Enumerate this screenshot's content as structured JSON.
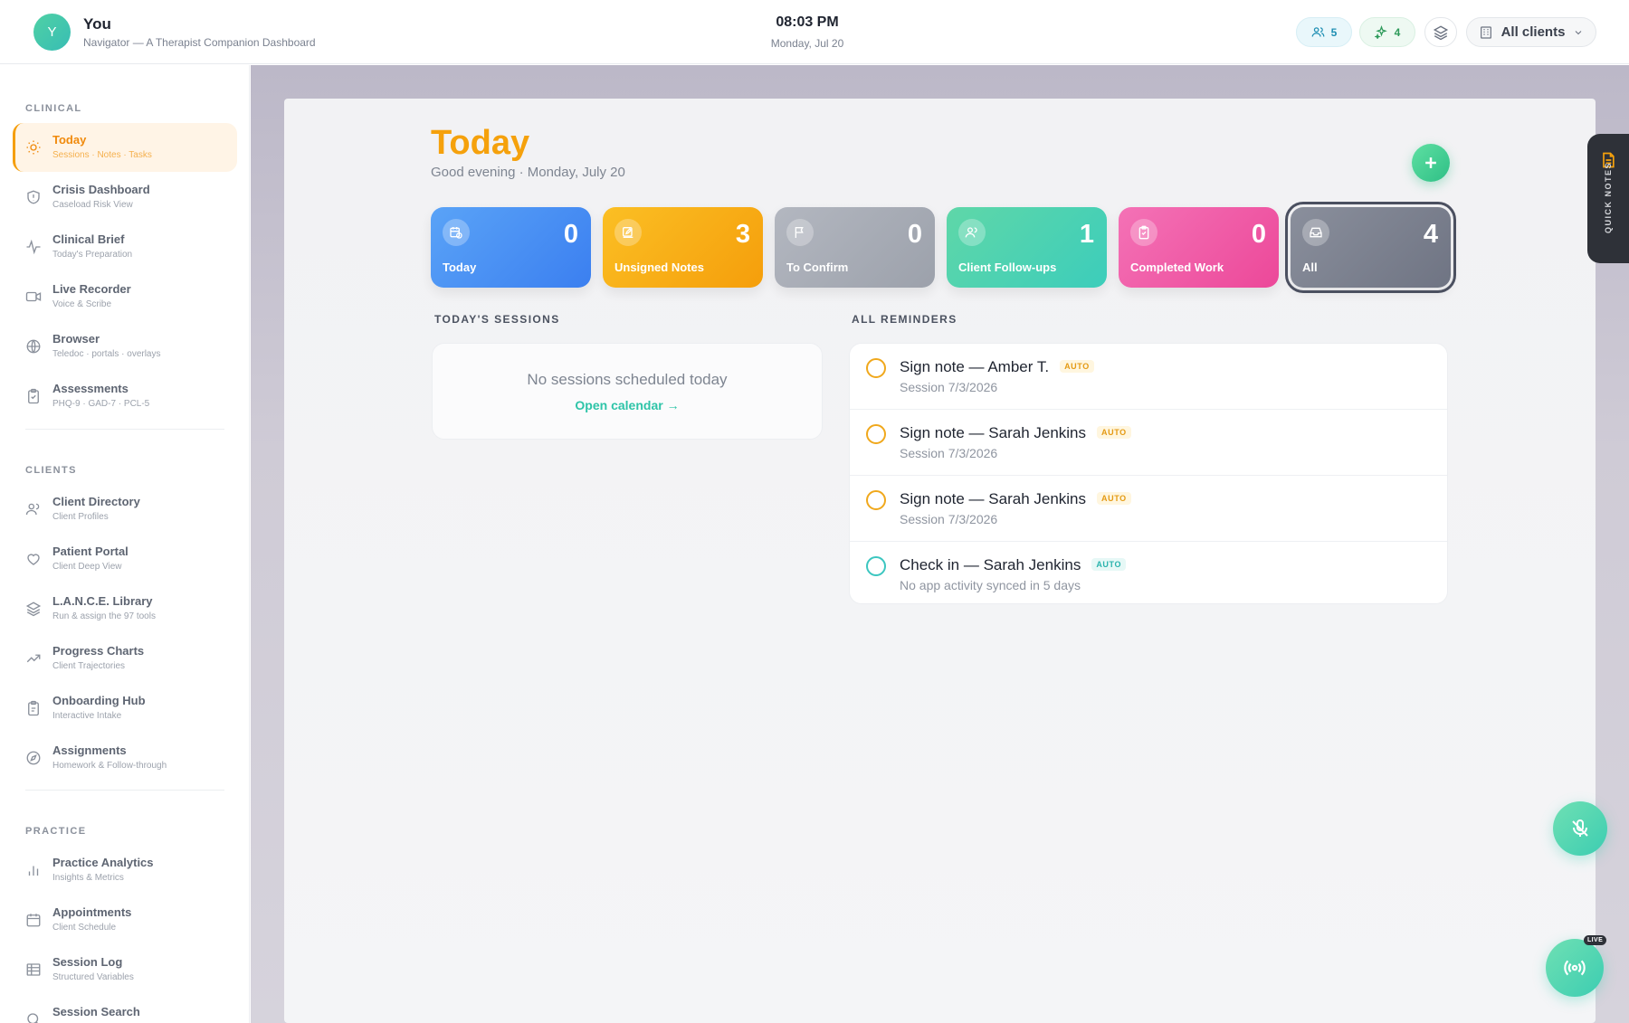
{
  "header": {
    "avatar_initial": "Y",
    "user_name": "You",
    "user_sub": "Navigator — A Therapist Companion Dashboard",
    "time": "08:03 PM",
    "date": "Monday, Jul 20",
    "clients_count": "5",
    "sparkle_count": "4",
    "client_select": "All clients"
  },
  "sidebar": {
    "clinical_title": "CLINICAL",
    "clients_title": "CLIENTS",
    "practice_title": "PRACTICE",
    "clinical": [
      {
        "label": "Today",
        "sub": "Sessions · Notes · Tasks",
        "icon": "sun-icon"
      },
      {
        "label": "Crisis Dashboard",
        "sub": "Caseload Risk View",
        "icon": "shield-icon"
      },
      {
        "label": "Clinical Brief",
        "sub": "Today's Preparation",
        "icon": "pulse-icon"
      },
      {
        "label": "Live Recorder",
        "sub": "Voice & Scribe",
        "icon": "video-icon"
      },
      {
        "label": "Browser",
        "sub": "Teledoc · portals · overlays",
        "icon": "globe-icon"
      },
      {
        "label": "Assessments",
        "sub": "PHQ-9 · GAD-7 · PCL-5",
        "icon": "clipboard-icon"
      }
    ],
    "clients": [
      {
        "label": "Client Directory",
        "sub": "Client Profiles",
        "icon": "users-icon"
      },
      {
        "label": "Patient Portal",
        "sub": "Client Deep View",
        "icon": "heart-icon"
      },
      {
        "label": "L.A.N.C.E. Library",
        "sub": "Run & assign the 97 tools",
        "icon": "layers-icon"
      },
      {
        "label": "Progress Charts",
        "sub": "Client Trajectories",
        "icon": "trend-icon"
      },
      {
        "label": "Onboarding Hub",
        "sub": "Interactive Intake",
        "icon": "clipboard-check-icon"
      },
      {
        "label": "Assignments",
        "sub": "Homework & Follow-through",
        "icon": "compass-icon"
      }
    ],
    "practice": [
      {
        "label": "Practice Analytics",
        "sub": "Insights & Metrics",
        "icon": "bar-chart-icon"
      },
      {
        "label": "Appointments",
        "sub": "Client Schedule",
        "icon": "calendar-icon"
      },
      {
        "label": "Session Log",
        "sub": "Structured Variables",
        "icon": "table-icon"
      },
      {
        "label": "Session Search",
        "sub": "",
        "icon": "search-icon"
      }
    ]
  },
  "main": {
    "title": "Today",
    "subtitle": "Good evening · Monday, July 20",
    "cards": [
      {
        "label": "Today",
        "count": "0"
      },
      {
        "label": "Unsigned Notes",
        "count": "3"
      },
      {
        "label": "To Confirm",
        "count": "0"
      },
      {
        "label": "Client Follow-ups",
        "count": "1"
      },
      {
        "label": "Completed Work",
        "count": "0"
      },
      {
        "label": "All",
        "count": "4"
      }
    ],
    "sessions_title": "TODAY'S SESSIONS",
    "no_sessions": "No sessions scheduled today",
    "open_calendar": "Open calendar →",
    "reminders_title": "ALL REMINDERS",
    "reminders": [
      {
        "title": "Sign note — Amber T.",
        "badge": "AUTO",
        "sub": "Session 7/3/2026"
      },
      {
        "title": "Sign note — Sarah Jenkins",
        "badge": "AUTO",
        "sub": "Session 7/3/2026"
      },
      {
        "title": "Sign note — Sarah Jenkins",
        "badge": "AUTO",
        "sub": "Session 7/3/2026"
      },
      {
        "title": "Check in — Sarah Jenkins",
        "badge": "AUTO",
        "sub": "No app activity synced in 5 days"
      }
    ]
  },
  "floating": {
    "quick_notes": "QUICK NOTES",
    "live_badge": "LIVE"
  },
  "colors": {
    "accent": "#f5a10c",
    "teal": "#2ec4a8"
  }
}
